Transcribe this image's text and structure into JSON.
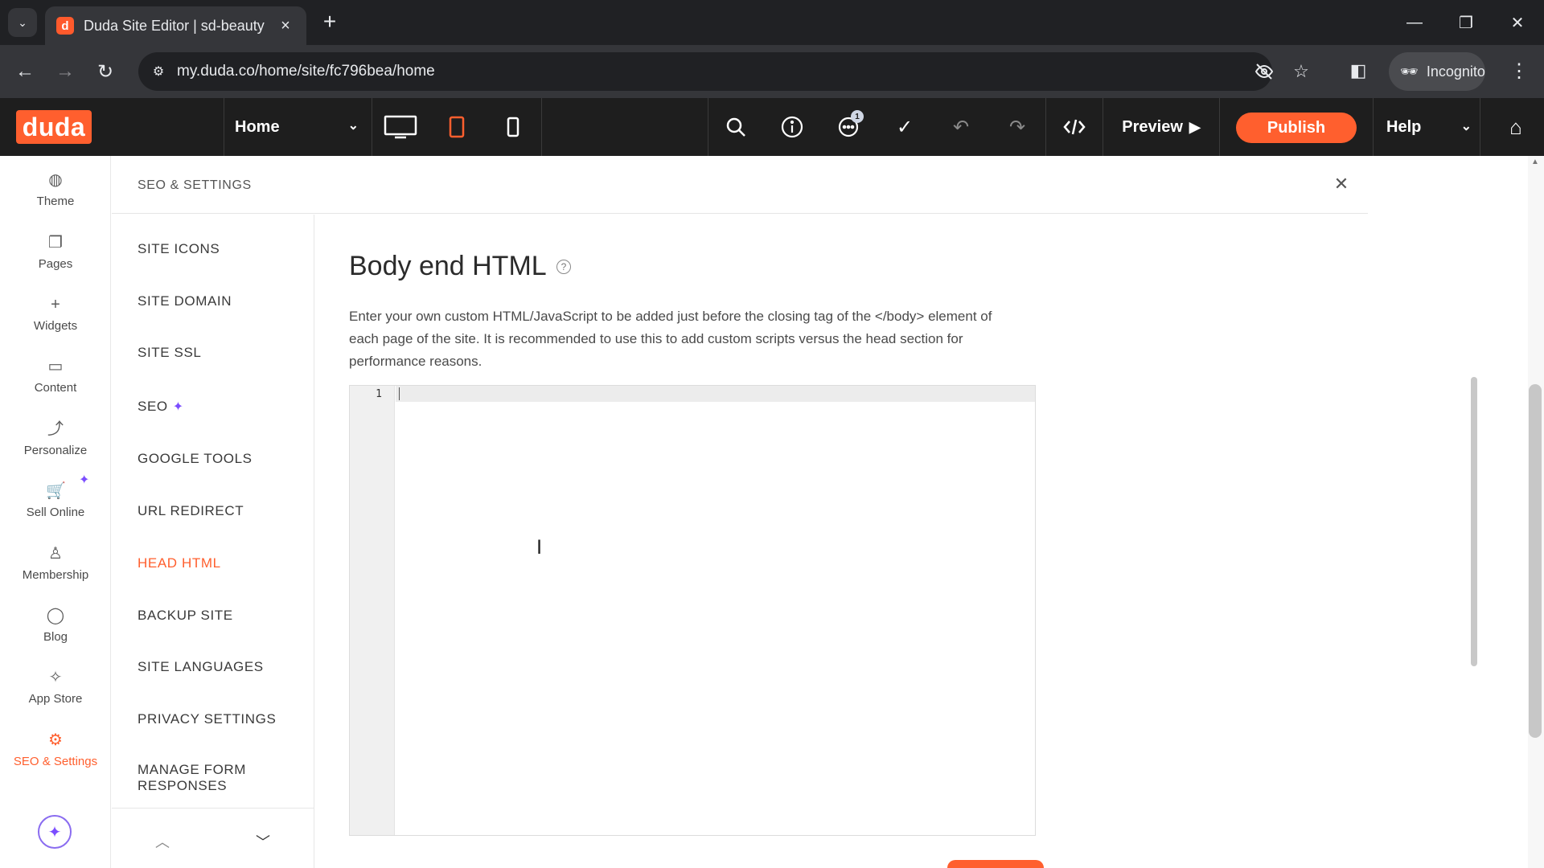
{
  "browser": {
    "tab_title": "Duda Site Editor | sd-beauty",
    "tab_favicon_letter": "d",
    "url": "my.duda.co/home/site/fc796bea/home",
    "incognito_label": "Incognito"
  },
  "toolbar": {
    "logo": "duda",
    "page_select": "Home",
    "comments_badge": "1",
    "preview_label": "Preview",
    "publish_label": "Publish",
    "help_label": "Help"
  },
  "rail": {
    "items": [
      {
        "label": "Theme",
        "icon": "palette-icon"
      },
      {
        "label": "Pages",
        "icon": "pages-icon"
      },
      {
        "label": "Widgets",
        "icon": "plus-icon"
      },
      {
        "label": "Content",
        "icon": "folder-icon"
      },
      {
        "label": "Personalize",
        "icon": "personalize-icon"
      },
      {
        "label": "Sell Online",
        "icon": "cart-icon"
      },
      {
        "label": "Membership",
        "icon": "person-icon"
      },
      {
        "label": "Blog",
        "icon": "chat-bubble-icon"
      },
      {
        "label": "App Store",
        "icon": "puzzle-icon"
      },
      {
        "label": "SEO & Settings",
        "icon": "gear-icon"
      }
    ]
  },
  "panel": {
    "title": "SEO & SETTINGS",
    "nav": [
      {
        "label": "SITE ICONS"
      },
      {
        "label": "SITE DOMAIN"
      },
      {
        "label": "SITE SSL"
      },
      {
        "label": "SEO"
      },
      {
        "label": "GOOGLE TOOLS"
      },
      {
        "label": "URL REDIRECT"
      },
      {
        "label": "HEAD HTML"
      },
      {
        "label": "BACKUP SITE"
      },
      {
        "label": "SITE LANGUAGES"
      },
      {
        "label": "PRIVACY SETTINGS"
      },
      {
        "label": "MANAGE FORM RESPONSES"
      }
    ],
    "active_nav": "HEAD HTML",
    "content": {
      "title": "Body end HTML",
      "description": "Enter your own custom HTML/JavaScript to be added just before the closing tag of the </body> element of each page of the site. It is recommended to use this to add custom scripts versus the head section for performance reasons.",
      "editor_line_number": "1",
      "editor_value": ""
    }
  },
  "colors": {
    "brand": "#ff5f2e",
    "ai_accent": "#7b4dff",
    "toolbar_bg": "#1e1e1e"
  }
}
